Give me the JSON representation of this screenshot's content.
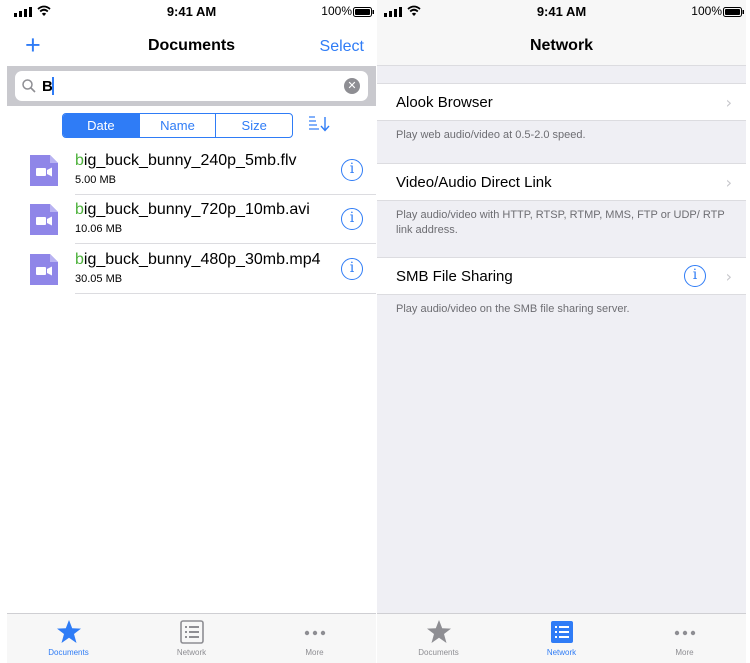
{
  "status": {
    "time": "9:41 AM",
    "battery": "100%"
  },
  "documents_screen": {
    "nav": {
      "title": "Documents",
      "add_label": "+",
      "select_label": "Select"
    },
    "search": {
      "query": "B",
      "clear_icon": "clear-icon"
    },
    "sort_segments": [
      {
        "label": "Date",
        "active": true
      },
      {
        "label": "Name",
        "active": false
      },
      {
        "label": "Size",
        "active": false
      }
    ],
    "files": [
      {
        "highlight": "b",
        "rest": "ig_buck_bunny_240p_5mb.flv",
        "size": "5.00 MB"
      },
      {
        "highlight": "b",
        "rest": "ig_buck_bunny_720p_10mb.avi",
        "size": "10.06 MB"
      },
      {
        "highlight": "b",
        "rest": "ig_buck_bunny_480p_30mb.mp4",
        "size": "30.05 MB"
      }
    ],
    "info_glyph": "i",
    "active_tab": "Documents"
  },
  "network_screen": {
    "nav": {
      "title": "Network"
    },
    "rows": [
      {
        "label": "Alook Browser",
        "description": "Play web audio/video at 0.5-2.0 speed.",
        "has_info": false
      },
      {
        "label": "Video/Audio Direct Link",
        "description": "Play audio/video with HTTP, RTSP, RTMP, MMS, FTP or UDP/ RTP link address.",
        "has_info": false
      },
      {
        "label": "SMB File Sharing",
        "description": "Play audio/video on the SMB file sharing server.",
        "has_info": true
      }
    ],
    "chevron": "›",
    "info_glyph": "i",
    "active_tab": "Network"
  },
  "tabs": [
    {
      "label": "Documents",
      "icon": "star-icon"
    },
    {
      "label": "Network",
      "icon": "list-icon"
    },
    {
      "label": "More",
      "icon": "more-icon"
    }
  ],
  "colors": {
    "accent": "#2f7cf6",
    "highlight": "#4cb13a",
    "file_icon": "#8f86e8",
    "inactive": "#8e8e93"
  }
}
